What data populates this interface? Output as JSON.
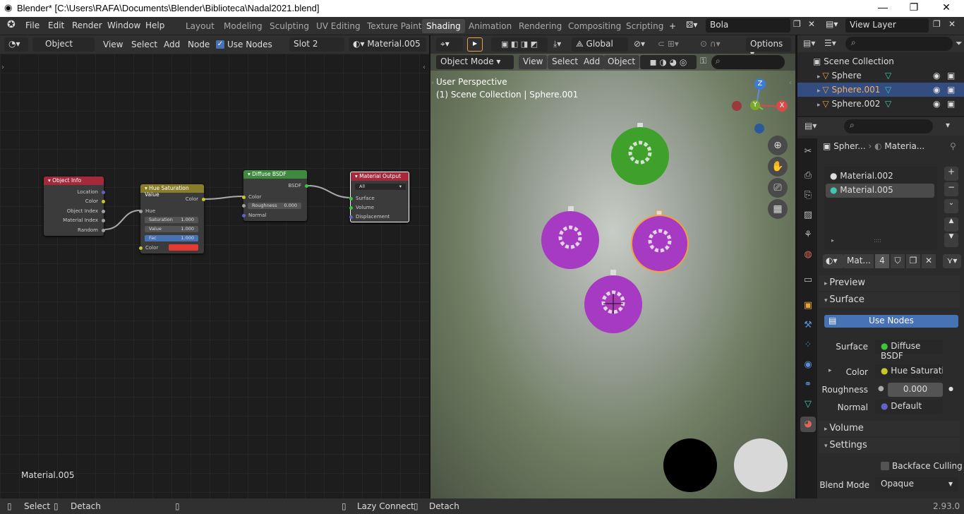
{
  "titlebar": {
    "title": "Blender* [C:\\Users\\RAFA\\Documents\\Blender\\Biblioteca\\Nadal2021.blend]",
    "minimize": "—",
    "maximize": "❐",
    "close": "✕"
  },
  "menus": [
    "File",
    "Edit",
    "Render",
    "Window",
    "Help"
  ],
  "workspaces": [
    "Layout",
    "Modeling",
    "Sculpting",
    "UV Editing",
    "Texture Paint",
    "Shading",
    "Animation",
    "Rendering",
    "Compositing",
    "Scripting"
  ],
  "active_workspace": "Shading",
  "scene_name": "Bola",
  "view_layer": "View Layer",
  "node_header": {
    "object": "Object",
    "menus": [
      "View",
      "Select",
      "Add",
      "Node"
    ],
    "use_nodes": "Use Nodes",
    "slot": "Slot 2",
    "material": "Material.005"
  },
  "nodes": {
    "object_info": {
      "title": "Object Info",
      "outputs": [
        "Location",
        "Color",
        "Object Index",
        "Material Index",
        "Random"
      ]
    },
    "hsv": {
      "title": "Hue Saturation Value",
      "output": "Color",
      "hue": "Hue",
      "saturation_label": "Saturation",
      "saturation": "1.000",
      "value_label": "Value",
      "value": "1.000",
      "fac_label": "Fac",
      "fac": "1.000",
      "color_label": "Color"
    },
    "diffuse": {
      "title": "Diffuse BSDF",
      "output": "BSDF",
      "color": "Color",
      "roughness_label": "Roughness",
      "roughness": "0.000",
      "normal": "Normal"
    },
    "output": {
      "title": "Material Output",
      "target": "All",
      "surface": "Surface",
      "volume": "Volume",
      "displacement": "Displacement"
    }
  },
  "node_editor_label": "Material.005",
  "viewport_header": {
    "mode": "Object Mode",
    "menus": [
      "View",
      "Select",
      "Add",
      "Object"
    ],
    "transform": "Global",
    "options": "Options"
  },
  "viewport": {
    "line1": "User Perspective",
    "line2": "(1) Scene Collection | Sphere.001",
    "gizmo": {
      "z": "Z",
      "y": "Y",
      "x": "X"
    }
  },
  "outliner": {
    "root": "Scene Collection",
    "items": [
      "Sphere",
      "Sphere.001",
      "Sphere.002"
    ]
  },
  "props": {
    "header": {
      "object": "Spher...",
      "material": "Materia..."
    },
    "slots": [
      "Material.002",
      "Material.005"
    ],
    "mat_name": "Mat...",
    "users": "4",
    "sections": {
      "preview": "Preview",
      "surface": "Surface",
      "volume": "Volume",
      "settings": "Settings"
    },
    "use_nodes": "Use Nodes",
    "surface_label": "Surface",
    "surface_value": "Diffuse BSDF",
    "color_label": "Color",
    "color_value": "Hue Saturatio...",
    "roughness_label": "Roughness",
    "roughness_value": "0.000",
    "normal_label": "Normal",
    "normal_value": "Default",
    "backface": "Backface Culling",
    "blend_label": "Blend Mode",
    "blend_value": "Opaque"
  },
  "status": {
    "select": "Select",
    "detach1": "Detach",
    "lazy": "Lazy Connect",
    "detach2": "Detach",
    "version": "2.93.0"
  },
  "colors": {
    "accent": "#4772b3",
    "object_info_header": "#a3293b",
    "hsv_header": "#8a7d2a",
    "diffuse_header": "#3f8a3f",
    "output_header": "#a3293b",
    "ball_purple": "#a63ac2",
    "ball_green": "#3fa12b"
  }
}
